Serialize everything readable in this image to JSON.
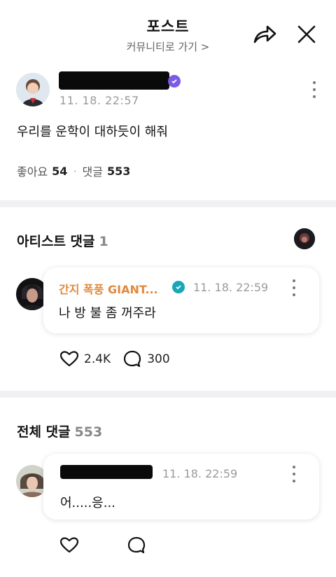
{
  "header": {
    "title": "포스트",
    "subtitle": "커뮤니티로 가기 >"
  },
  "post": {
    "time": "11. 18. 22:57",
    "text": "우리를 운학이 대하듯이 해줘",
    "likes_label": "좋아요",
    "likes": "54",
    "comments_label": "댓글",
    "comments": "553"
  },
  "artist_section": {
    "title": "아티스트 댓글",
    "count": "1",
    "comment": {
      "name": "간지 폭풍 GIANT...",
      "time": "11. 18. 22:59",
      "text": "나 방 불 좀 꺼주라",
      "likes": "2.4K",
      "replies": "300"
    }
  },
  "all_section": {
    "title": "전체 댓글",
    "count": "553",
    "comment": {
      "time": "11. 18. 22:59",
      "text": "어.....응..."
    }
  },
  "colors": {
    "artist_name": "#e0893b",
    "post_verified": "#7b5be6",
    "artist_verified": "#1aa6b7",
    "divider": "#f1f1f3"
  }
}
